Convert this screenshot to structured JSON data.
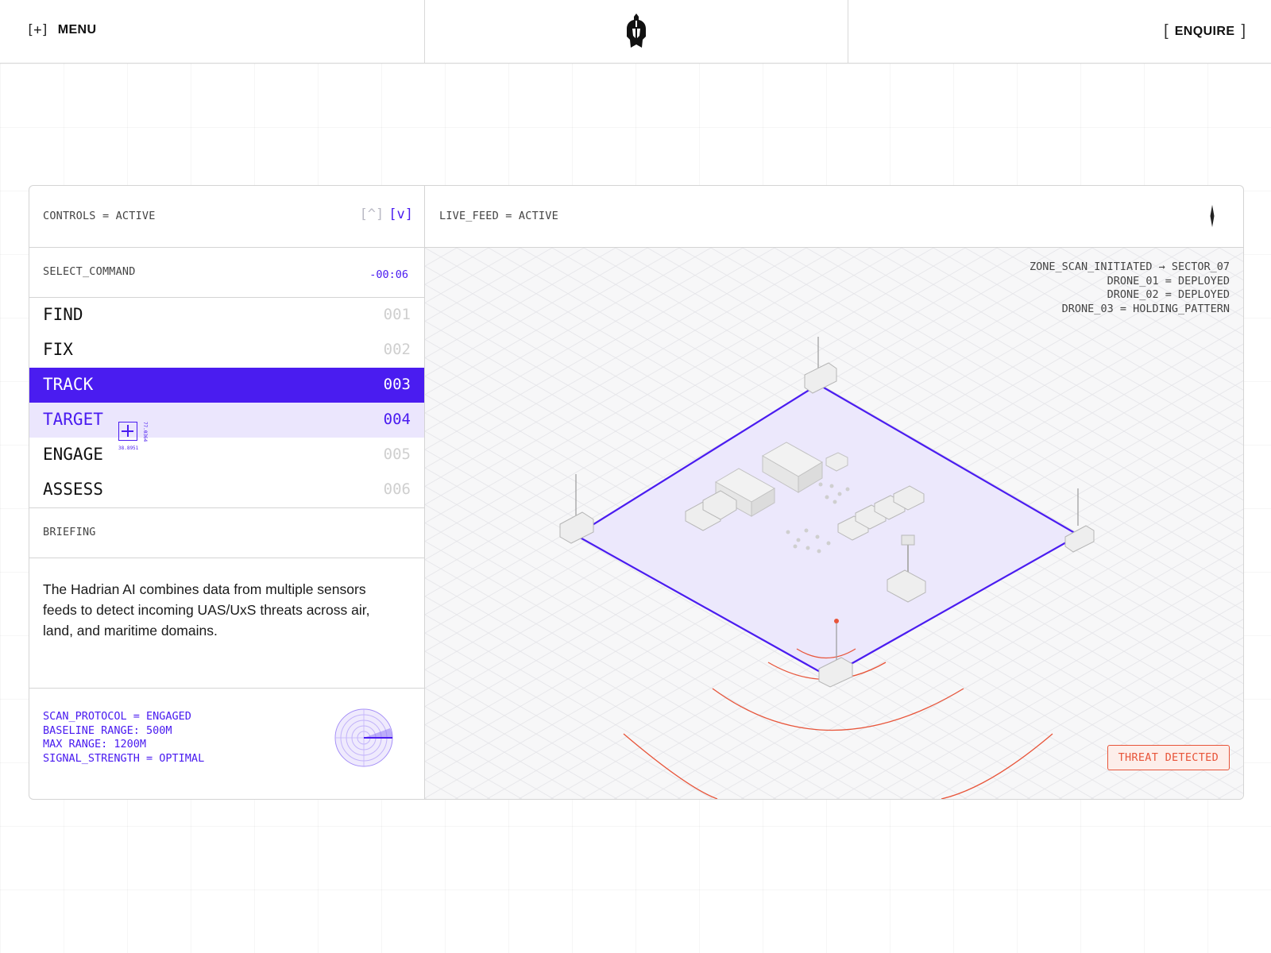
{
  "header": {
    "menu_label": "MENU",
    "enquire_label": "ENQUIRE",
    "menu_icon": "plus-bracket-icon",
    "logo_icon": "spartan-helmet-logo"
  },
  "controls": {
    "status": "CONTROLS = ACTIVE",
    "select_label": "SELECT_COMMAND",
    "timer": "-00:06",
    "commands": [
      {
        "name": "FIND",
        "number": "001"
      },
      {
        "name": "FIX",
        "number": "002"
      },
      {
        "name": "TRACK",
        "number": "003"
      },
      {
        "name": "TARGET",
        "number": "004"
      },
      {
        "name": "ENGAGE",
        "number": "005"
      },
      {
        "name": "ASSESS",
        "number": "006"
      }
    ],
    "active_command": "TRACK",
    "hovered_command": "TARGET",
    "target_coord_lat": "38.8951",
    "target_coord_lon": "77.0364",
    "briefing_label": "BRIEFING",
    "briefing_text": "The Hadrian AI combines data from multiple sensors feeds to detect incoming UAS/UxS threats across air, land, and maritime domains.",
    "scan_info": [
      "SCAN_PROTOCOL = ENGAGED",
      "BASELINE RANGE: 500M",
      "MAX RANGE: 1200M",
      "SIGNAL_STRENGTH = OPTIMAL"
    ]
  },
  "live_feed": {
    "status": "LIVE_FEED = ACTIVE",
    "status_lines": [
      "ZONE_SCAN_INITIATED → SECTOR_07",
      "DRONE_01 = DEPLOYED",
      "DRONE_02 = DEPLOYED",
      "DRONE_03 = HOLDING_PATTERN"
    ],
    "threat_label": "THREAT DETECTED"
  },
  "colors": {
    "accent": "#4a1cf0",
    "accent_light": "#ebe6fd",
    "threat": "#e8553a"
  }
}
